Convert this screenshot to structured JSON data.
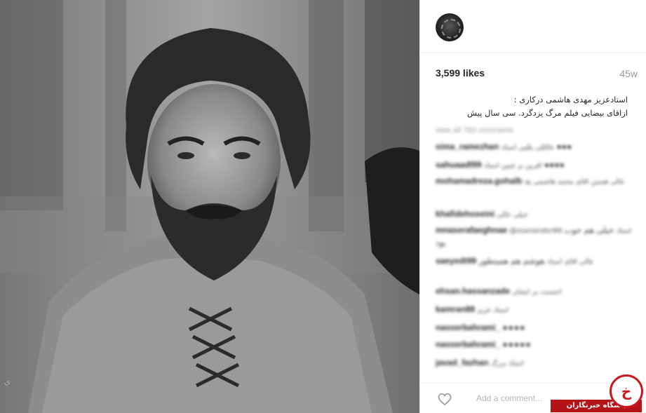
{
  "post": {
    "likes": "3,599 likes",
    "age": "45w",
    "caption_line1": "استادعزیز مهدی هاشمی درکاری :",
    "caption_line2": "ازاقای بیضایی فیلم مرگ یزدگرد. سی سال پیش"
  },
  "comments_section": {
    "view_all": "view all 783 comments",
    "items": [
      {
        "user": "sima_ramezhan",
        "text": "عالللی بللیی استاد",
        "emoji": "●●●"
      },
      {
        "user": "sahuaadl99",
        "text": "افرین بر چنین استاد",
        "emoji": "●●●●"
      },
      {
        "user": "mohamadreza.gohalb",
        "text": "عالی هستن اقای محمد هاشمی",
        "emoji": "ید"
      },
      {
        "user": "khafidehoseini",
        "text": "خیلی عالی",
        "emoji": ""
      },
      {
        "user": "mnaserafaeghnae",
        "text": "@ssanander88 استاد",
        "emoji": "خیلی هم خوب بود"
      },
      {
        "user": "saeyedt99",
        "text": "عالی اقای استاد",
        "emoji": "هوشم هم همینطور"
      },
      {
        "user": "ehsan.hassanzade",
        "text": "احسنت بر ایشان",
        "emoji": ""
      },
      {
        "user": "kamran88",
        "text": "استاد عزیز",
        "emoji": ""
      },
      {
        "user": "nasserbahrami_",
        "text": "",
        "emoji": "●●●●"
      },
      {
        "user": "nasserbahrami_",
        "text": "",
        "emoji": "●●●●●"
      },
      {
        "user": "javad_fazhan",
        "text": "استاد بزرگ",
        "emoji": ""
      }
    ]
  },
  "footer": {
    "placeholder": "Add a comment..."
  },
  "logo": {
    "glyph": "خ",
    "label": "باشگاه خبرنگاران"
  },
  "icons": {
    "heart": "heart-icon",
    "avatar": "avatar"
  },
  "colors": {
    "accent_red": "#c8181e",
    "muted": "#999999",
    "text": "#262626"
  }
}
